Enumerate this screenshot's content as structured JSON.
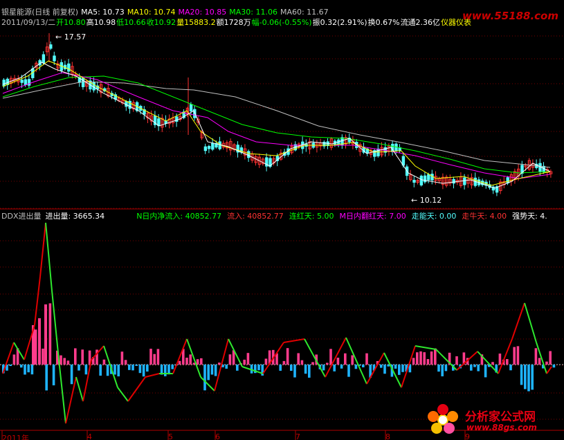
{
  "header": {
    "title": "银星能源(日线 前复权)",
    "ma5": "MA5: 10.73",
    "ma10": "MA10: 10.74",
    "ma20": "MA20: 10.85",
    "ma30": "MA30: 11.06",
    "ma60": "MA60: 11.67",
    "date": "2011/09/13/二",
    "open": "开10.80",
    "high": "高10.98",
    "low": "低10.66",
    "close": "收10.92",
    "volume": "量15883.2",
    "amount": "额1728万",
    "change": "幅-0.06(-0.55%)",
    "amplitude": "振0.32(2.91%)",
    "turnover": "换0.67%",
    "float": "流通2.36亿",
    "sector": "仪器仪表"
  },
  "price_panel": {
    "high_label": "17.57",
    "low_label": "10.12"
  },
  "indicator": {
    "name": "DDX进出量",
    "inout": "进出量: 3665.34",
    "net_inflow": "N日内净流入: 40852.77",
    "inflow": "流入: 40852.77",
    "red_days": "连红天: 5.00",
    "m_red": "M日内翻红天: 7.00",
    "can_go": "走能天: 0.00",
    "bull_days": "走牛天: 4.00",
    "strong_days": "强势天: 4."
  },
  "x_axis": [
    "2011年",
    "4",
    "5",
    "6",
    "7",
    "8",
    "9"
  ],
  "watermark": {
    "top_logo": "www.55188.com",
    "brand": "分析家公式网",
    "url": "www.88gs.com"
  },
  "colors": {
    "up": "#ff3232",
    "down": "#54ffff",
    "ma5": "#ffffff",
    "ma10": "#ffff00",
    "ma20": "#ff00ff",
    "ma30": "#00ff00",
    "ma60": "#c0c0c0"
  },
  "chart_data": [
    {
      "type": "candlestick",
      "title": "银星能源(日线 前复权)",
      "ylim": [
        10.12,
        17.57
      ],
      "annotations": [
        "17.57",
        "10.12"
      ],
      "series": [
        {
          "name": "MA5",
          "values": [
            10.73
          ]
        },
        {
          "name": "MA10",
          "values": [
            10.74
          ]
        },
        {
          "name": "MA20",
          "values": [
            10.85
          ]
        },
        {
          "name": "MA30",
          "values": [
            11.06
          ]
        },
        {
          "name": "MA60",
          "values": [
            11.67
          ]
        }
      ]
    },
    {
      "type": "bar",
      "title": "DDX进出量",
      "series": [
        {
          "name": "进出量",
          "values": [
            3665.34
          ]
        },
        {
          "name": "N日内净流入",
          "values": [
            40852.77
          ]
        },
        {
          "name": "流入",
          "values": [
            40852.77
          ]
        }
      ]
    }
  ]
}
